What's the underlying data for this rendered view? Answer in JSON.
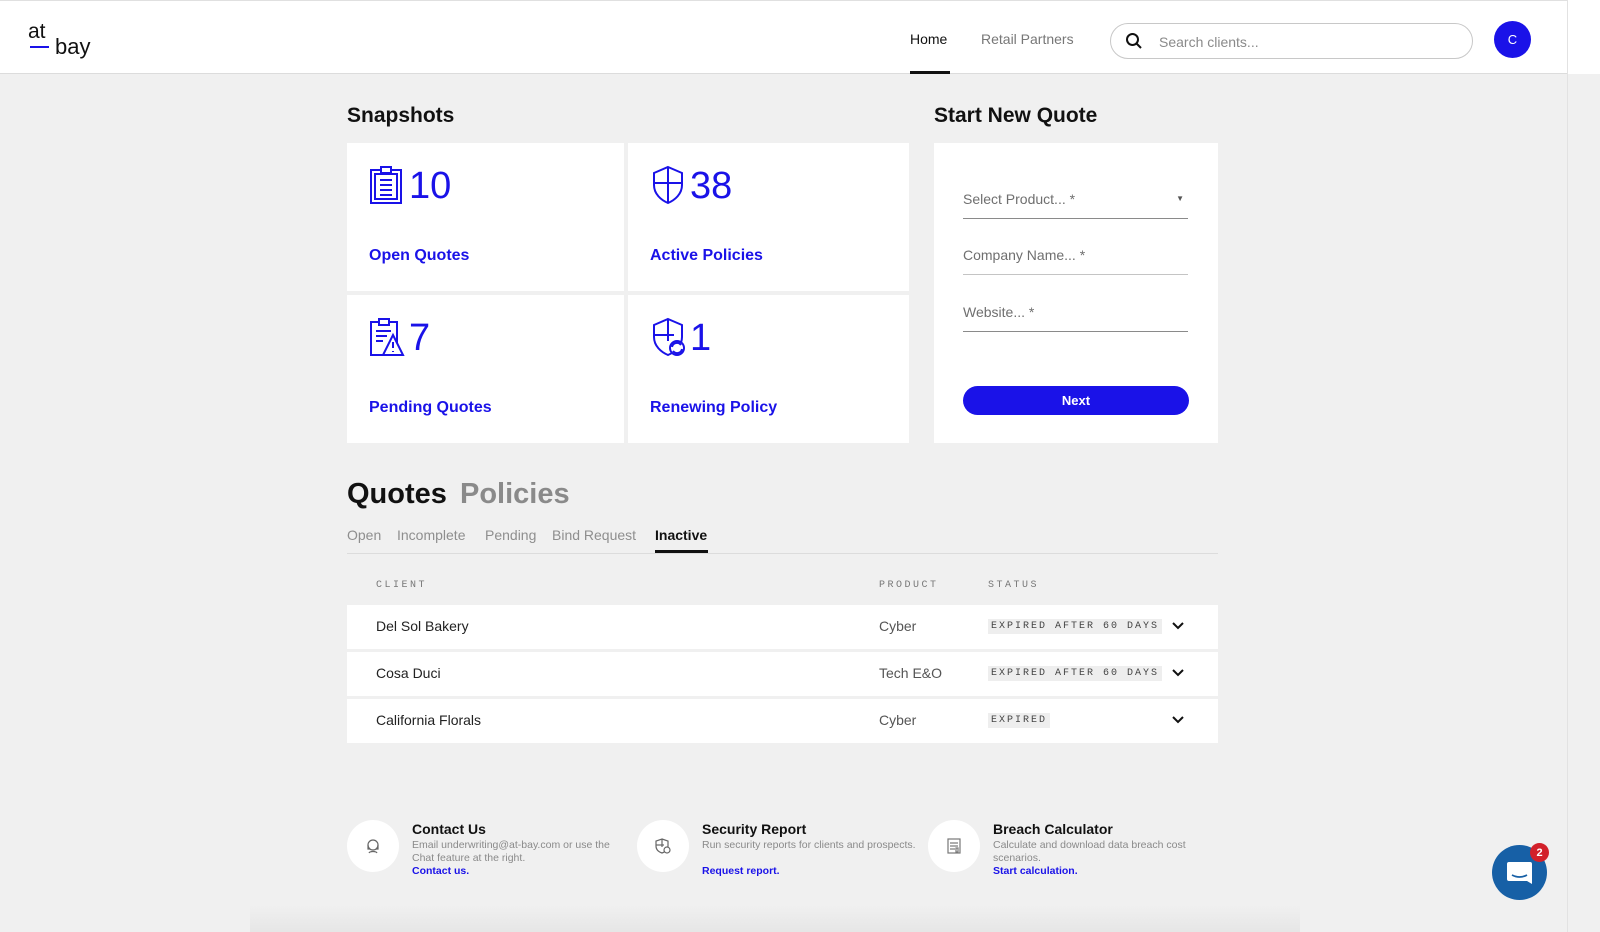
{
  "header": {
    "logo_top": "at",
    "logo_bottom": "bay",
    "nav": [
      {
        "label": "Home",
        "active": true
      },
      {
        "label": "Retail Partners",
        "active": false
      }
    ],
    "search_placeholder": "Search clients...",
    "avatar_initial": "C"
  },
  "snapshots": {
    "title": "Snapshots",
    "cards": [
      {
        "count": "10",
        "label": "Open Quotes",
        "icon": "clipboard-icon"
      },
      {
        "count": "38",
        "label": "Active Policies",
        "icon": "shield-icon"
      },
      {
        "count": "7",
        "label": "Pending Quotes",
        "icon": "clipboard-warning-icon"
      },
      {
        "count": "1",
        "label": "Renewing Policy",
        "icon": "shield-refresh-icon"
      }
    ]
  },
  "new_quote": {
    "title": "Start New Quote",
    "product_placeholder": "Select Product... *",
    "company_placeholder": "Company Name... *",
    "website_placeholder": "Website... *",
    "next_label": "Next"
  },
  "list": {
    "main_tabs": [
      {
        "label": "Quotes",
        "active": true
      },
      {
        "label": "Policies",
        "active": false
      }
    ],
    "sub_tabs": [
      {
        "label": "Open",
        "active": false
      },
      {
        "label": "Incomplete",
        "active": false
      },
      {
        "label": "Pending",
        "active": false
      },
      {
        "label": "Bind Request",
        "active": false
      },
      {
        "label": "Inactive",
        "active": true
      }
    ],
    "columns": {
      "client": "CLIENT",
      "product": "PRODUCT",
      "status": "STATUS"
    },
    "rows": [
      {
        "client": "Del Sol Bakery",
        "product": "Cyber",
        "status": "EXPIRED AFTER 60 DAYS"
      },
      {
        "client": "Cosa Duci",
        "product": "Tech E&O",
        "status": "EXPIRED AFTER 60 DAYS"
      },
      {
        "client": "California Florals",
        "product": "Cyber",
        "status": "EXPIRED"
      }
    ]
  },
  "footer": [
    {
      "title": "Contact Us",
      "desc": "Email underwriting@at-bay.com or use the Chat feature at the right.",
      "link": "Contact us.",
      "icon": "support-agent-icon"
    },
    {
      "title": "Security Report",
      "desc": "Run security reports for clients and prospects.",
      "link": "Request report.",
      "icon": "shield-gear-icon"
    },
    {
      "title": "Breach Calculator",
      "desc": "Calculate and download data breach cost scenarios.",
      "link": "Start calculation.",
      "icon": "calculator-icon"
    }
  ],
  "chat": {
    "badge_count": "2"
  },
  "colors": {
    "accent": "#1a12e8",
    "chat": "#1760a6",
    "badge": "#d2202a"
  }
}
